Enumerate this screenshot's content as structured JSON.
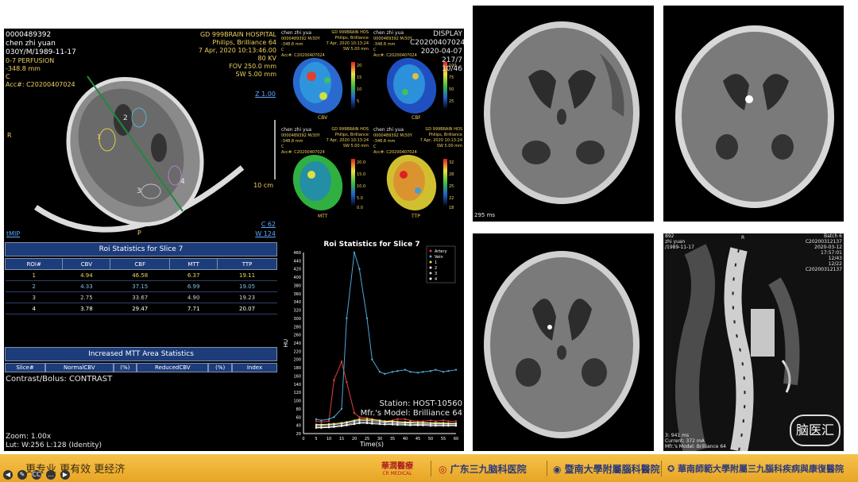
{
  "left_view": {
    "tl_lines": [
      "0000489392",
      "chen zhi yuan",
      "030Y/M/1989-11-17",
      "0-7 PERFUSION",
      "-348.8 mm",
      "C",
      "Acc#: C20200407024"
    ],
    "tr_lines": [
      "GD 999BRAIN HOSPITAL",
      "Philips, Brilliance 64",
      "7 Apr, 2020 10:13:46.00",
      "80 KV",
      "FOV 250.0 mm",
      "SW 5.00 mm"
    ],
    "zoom_label": "Z 1.00",
    "side_label_r": "R",
    "scale_label": "10 cm",
    "bl_label": "tMIP",
    "bottom_label_p": "P",
    "window_c": "C 62",
    "window_w": "W 124",
    "roi_labels": [
      "1",
      "2",
      "3",
      "4"
    ]
  },
  "maps": [
    {
      "name": "CBV",
      "lines": [
        "chen zhi yua",
        "0000489392 M/30Y",
        "-348.8 mm",
        "C",
        "Acc#: C20200407024"
      ],
      "hosp": [
        "GD 999BRAIN HOS",
        "Philips, Brilliance",
        "7 Apr, 2020 10:13:24",
        "SW 5.00 mm"
      ],
      "scale": [
        "20",
        "15",
        "10",
        "5",
        "0"
      ]
    },
    {
      "name": "CBF",
      "lines": [
        "chen zhi yua",
        "0000489392 M/30Y",
        "-348.8 mm",
        "C",
        "Acc#: C20200407024"
      ],
      "hosp": [
        "GD 999BRAIN HOS",
        "Philips, Brilliance",
        "7 Apr, 2020 10:13:24",
        "SW 5.00 mm"
      ],
      "scale": [
        "100",
        "75",
        "50",
        "25",
        "0"
      ]
    },
    {
      "name": "MTT",
      "lines": [
        "chen zhi yua",
        "0000489392 M/30Y",
        "-348.8 mm",
        "C",
        "Acc#: C20200407024"
      ],
      "hosp": [
        "GD 999BRAIN HOS",
        "Philips, Brilliance",
        "7 Apr, 2020 10:13:24",
        "SW 5.00 mm"
      ],
      "scale": [
        "20.0",
        "15.0",
        "10.0",
        "5.0",
        "0.0"
      ]
    },
    {
      "name": "TTP",
      "lines": [
        "chen zhi yua",
        "0000489392 M/30Y",
        "-348.8 mm",
        "C",
        "Acc#: C20200407024"
      ],
      "hosp": [
        "GD 999BRAIN HOS",
        "Philips, Brilliance",
        "7 Apr, 2020 10:13:24",
        "SW 5.00 mm"
      ],
      "scale": [
        "32",
        "28",
        "25",
        "22",
        "18"
      ]
    }
  ],
  "overlay_display": [
    "DISPLAY",
    "C20200407024",
    "2020-04-07",
    "217/7",
    "10/46"
  ],
  "roi_table": {
    "title": "Roi Statistics for Slice 7",
    "columns": [
      "ROI#",
      "CBV",
      "CBF",
      "MTT",
      "TTP"
    ],
    "rows": [
      [
        "1",
        "4.94",
        "46.58",
        "6.37",
        "19.11"
      ],
      [
        "2",
        "4.33",
        "37.15",
        "6.99",
        "19.05"
      ],
      [
        "3",
        "2.75",
        "33.67",
        "4.90",
        "19.23"
      ],
      [
        "4",
        "3.78",
        "29.47",
        "7.71",
        "20.07"
      ]
    ]
  },
  "mtt_table": {
    "title": "Increased MTT Area Statistics",
    "columns": [
      "Slice#",
      "NormalCBV",
      "(%)",
      "ReducedCBV",
      "(%)",
      "Index"
    ],
    "contrast": "Contrast/Bolus: CONTRAST",
    "zoom": "Zoom: 1.00x",
    "lut": "Lut: W:256 L:128 (Identity)"
  },
  "chart_data": {
    "type": "line",
    "title": "Roi Statistics for Slice 7",
    "xlabel": "Time(s)",
    "ylabel": "HU",
    "x": [
      5,
      7,
      10,
      12,
      15,
      17,
      20,
      22,
      25,
      27,
      30,
      32,
      35,
      37,
      40,
      42,
      45,
      47,
      50,
      52,
      55,
      57,
      60
    ],
    "xlim": [
      0,
      60
    ],
    "ylim": [
      20,
      460
    ],
    "xticks": [
      0,
      5,
      10,
      15,
      20,
      25,
      30,
      35,
      40,
      45,
      50,
      55,
      60
    ],
    "yticks": [
      20,
      40,
      60,
      80,
      100,
      120,
      140,
      160,
      180,
      200,
      220,
      240,
      260,
      280,
      300,
      320,
      340,
      360,
      380,
      400,
      420,
      440,
      460
    ],
    "legend_position": "top-right",
    "series": [
      {
        "name": "Artery",
        "color": "#e04040",
        "values": [
          50,
          48,
          50,
          150,
          195,
          145,
          70,
          60,
          58,
          55,
          52,
          50,
          52,
          55,
          55,
          52,
          50,
          50,
          52,
          50,
          52,
          50,
          50
        ]
      },
      {
        "name": "Vein",
        "color": "#4fa8d8",
        "values": [
          55,
          52,
          55,
          60,
          80,
          300,
          460,
          420,
          300,
          200,
          170,
          165,
          170,
          172,
          175,
          170,
          168,
          170,
          172,
          175,
          170,
          172,
          175
        ]
      },
      {
        "name": "1",
        "color": "#f0e050",
        "values": [
          42,
          42,
          43,
          44,
          46,
          48,
          52,
          55,
          55,
          54,
          52,
          50,
          50,
          49,
          48,
          48,
          47,
          47,
          46,
          46,
          46,
          45,
          45
        ]
      },
      {
        "name": "2",
        "color": "#e8e8e8",
        "values": [
          40,
          40,
          41,
          42,
          44,
          46,
          50,
          52,
          52,
          51,
          50,
          48,
          48,
          47,
          46,
          46,
          45,
          45,
          45,
          44,
          44,
          44,
          44
        ]
      },
      {
        "name": "3",
        "color": "#d0d0d0",
        "values": [
          36,
          36,
          37,
          38,
          40,
          42,
          46,
          48,
          48,
          47,
          46,
          45,
          44,
          44,
          43,
          43,
          42,
          42,
          42,
          41,
          41,
          41,
          41
        ]
      },
      {
        "name": "4",
        "color": "#ffffff",
        "values": [
          34,
          34,
          35,
          36,
          38,
          40,
          43,
          45,
          45,
          44,
          43,
          42,
          42,
          41,
          41,
          40,
          40,
          40,
          39,
          39,
          39,
          39,
          39
        ]
      }
    ]
  },
  "station_info": [
    "Station: HOST-10560",
    "Mfr.'s Model: Brilliance 64"
  ],
  "ct_top_left_label": "295 ms",
  "spine": {
    "tl_lines": [
      "892",
      "zhi yuan",
      "/1989-11-17"
    ],
    "tr_lines": [
      "Batch 6",
      "C20200312137",
      "2020-03-12",
      "17:57:01",
      "12/43",
      "12/22",
      "C20200312137"
    ],
    "bl_lines": [
      "3: 941 ms",
      "Current: 372 mA",
      "Mfr.'s Model: Brilliance 64"
    ],
    "r_label": "R"
  },
  "watermark": "脑医汇",
  "bottom_bar": {
    "slogan": "更专业  更有效  更经济",
    "sponsors": [
      "華潤醫療",
      "CR MEDICAL",
      "广东三九脑科医院",
      "暨南大學附屬腦科醫院",
      "華南師範大學附屬三九腦科疾病與康復醫院"
    ],
    "controls": [
      "◀",
      "✎",
      "CC",
      "…",
      "▶"
    ]
  }
}
